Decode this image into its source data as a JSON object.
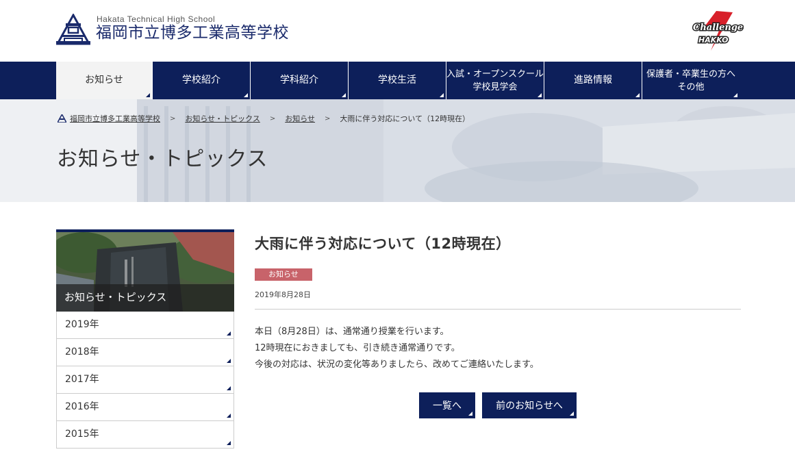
{
  "header": {
    "school_name_en": "Hakata Technical High School",
    "school_name_jp": "福岡市立博多工業高等学校",
    "logo_icon": "school-crest-icon",
    "challenge_logo_icon": "challenge-hakko-logo-icon"
  },
  "nav": {
    "items": [
      {
        "label": "お知らせ"
      },
      {
        "label": "学校紹介"
      },
      {
        "label": "学科紹介"
      },
      {
        "label": "学校生活"
      },
      {
        "label_line1": "入試・オープンスクール",
        "label_line2": "学校見学会"
      },
      {
        "label": "進路情報"
      },
      {
        "label_line1": "保護者・卒業生の方へ",
        "label_line2": "その他"
      }
    ]
  },
  "breadcrumb": {
    "home": "福岡市立博多工業高等学校",
    "level1": "お知らせ・トピックス",
    "level2": "お知らせ",
    "current": "大雨に伴う対応について（12時現在）",
    "separator": ">"
  },
  "hero": {
    "title": "お知らせ・トピックス"
  },
  "sidebar": {
    "heading": "お知らせ・トピックス",
    "years": [
      "2019年",
      "2018年",
      "2017年",
      "2016年",
      "2015年"
    ]
  },
  "post": {
    "title": "大雨に伴う対応について（12時現在）",
    "category": "お知らせ",
    "date": "2019年8月28日",
    "lines": [
      "本日（8月28日）は、通常通り授業を行います。",
      "12時現在におきましても、引き続き通常通りです。",
      "今後の対応は、状況の変化等ありましたら、改めてご連絡いたします。"
    ]
  },
  "buttons": {
    "list": "一覧へ",
    "prev": "前のお知らせへ"
  },
  "colors": {
    "navy": "#0d1f5a",
    "badge": "#c8636a"
  }
}
